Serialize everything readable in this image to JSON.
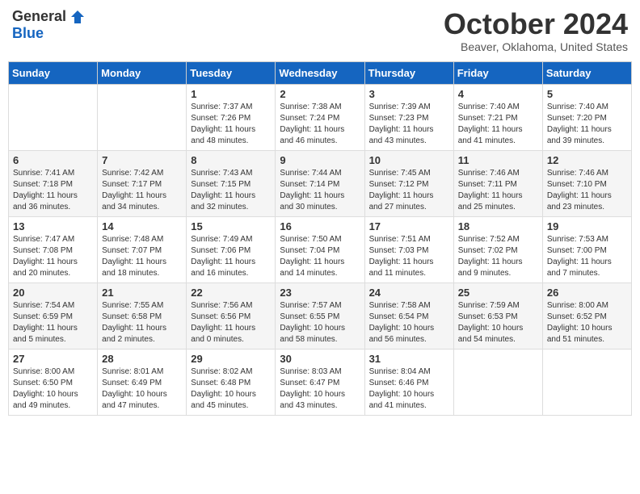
{
  "header": {
    "logo_general": "General",
    "logo_blue": "Blue",
    "month_title": "October 2024",
    "location": "Beaver, Oklahoma, United States"
  },
  "weekdays": [
    "Sunday",
    "Monday",
    "Tuesday",
    "Wednesday",
    "Thursday",
    "Friday",
    "Saturday"
  ],
  "weeks": [
    [
      {
        "day": "",
        "sunrise": "",
        "sunset": "",
        "daylight": ""
      },
      {
        "day": "",
        "sunrise": "",
        "sunset": "",
        "daylight": ""
      },
      {
        "day": "1",
        "sunrise": "Sunrise: 7:37 AM",
        "sunset": "Sunset: 7:26 PM",
        "daylight": "Daylight: 11 hours and 48 minutes."
      },
      {
        "day": "2",
        "sunrise": "Sunrise: 7:38 AM",
        "sunset": "Sunset: 7:24 PM",
        "daylight": "Daylight: 11 hours and 46 minutes."
      },
      {
        "day": "3",
        "sunrise": "Sunrise: 7:39 AM",
        "sunset": "Sunset: 7:23 PM",
        "daylight": "Daylight: 11 hours and 43 minutes."
      },
      {
        "day": "4",
        "sunrise": "Sunrise: 7:40 AM",
        "sunset": "Sunset: 7:21 PM",
        "daylight": "Daylight: 11 hours and 41 minutes."
      },
      {
        "day": "5",
        "sunrise": "Sunrise: 7:40 AM",
        "sunset": "Sunset: 7:20 PM",
        "daylight": "Daylight: 11 hours and 39 minutes."
      }
    ],
    [
      {
        "day": "6",
        "sunrise": "Sunrise: 7:41 AM",
        "sunset": "Sunset: 7:18 PM",
        "daylight": "Daylight: 11 hours and 36 minutes."
      },
      {
        "day": "7",
        "sunrise": "Sunrise: 7:42 AM",
        "sunset": "Sunset: 7:17 PM",
        "daylight": "Daylight: 11 hours and 34 minutes."
      },
      {
        "day": "8",
        "sunrise": "Sunrise: 7:43 AM",
        "sunset": "Sunset: 7:15 PM",
        "daylight": "Daylight: 11 hours and 32 minutes."
      },
      {
        "day": "9",
        "sunrise": "Sunrise: 7:44 AM",
        "sunset": "Sunset: 7:14 PM",
        "daylight": "Daylight: 11 hours and 30 minutes."
      },
      {
        "day": "10",
        "sunrise": "Sunrise: 7:45 AM",
        "sunset": "Sunset: 7:12 PM",
        "daylight": "Daylight: 11 hours and 27 minutes."
      },
      {
        "day": "11",
        "sunrise": "Sunrise: 7:46 AM",
        "sunset": "Sunset: 7:11 PM",
        "daylight": "Daylight: 11 hours and 25 minutes."
      },
      {
        "day": "12",
        "sunrise": "Sunrise: 7:46 AM",
        "sunset": "Sunset: 7:10 PM",
        "daylight": "Daylight: 11 hours and 23 minutes."
      }
    ],
    [
      {
        "day": "13",
        "sunrise": "Sunrise: 7:47 AM",
        "sunset": "Sunset: 7:08 PM",
        "daylight": "Daylight: 11 hours and 20 minutes."
      },
      {
        "day": "14",
        "sunrise": "Sunrise: 7:48 AM",
        "sunset": "Sunset: 7:07 PM",
        "daylight": "Daylight: 11 hours and 18 minutes."
      },
      {
        "day": "15",
        "sunrise": "Sunrise: 7:49 AM",
        "sunset": "Sunset: 7:06 PM",
        "daylight": "Daylight: 11 hours and 16 minutes."
      },
      {
        "day": "16",
        "sunrise": "Sunrise: 7:50 AM",
        "sunset": "Sunset: 7:04 PM",
        "daylight": "Daylight: 11 hours and 14 minutes."
      },
      {
        "day": "17",
        "sunrise": "Sunrise: 7:51 AM",
        "sunset": "Sunset: 7:03 PM",
        "daylight": "Daylight: 11 hours and 11 minutes."
      },
      {
        "day": "18",
        "sunrise": "Sunrise: 7:52 AM",
        "sunset": "Sunset: 7:02 PM",
        "daylight": "Daylight: 11 hours and 9 minutes."
      },
      {
        "day": "19",
        "sunrise": "Sunrise: 7:53 AM",
        "sunset": "Sunset: 7:00 PM",
        "daylight": "Daylight: 11 hours and 7 minutes."
      }
    ],
    [
      {
        "day": "20",
        "sunrise": "Sunrise: 7:54 AM",
        "sunset": "Sunset: 6:59 PM",
        "daylight": "Daylight: 11 hours and 5 minutes."
      },
      {
        "day": "21",
        "sunrise": "Sunrise: 7:55 AM",
        "sunset": "Sunset: 6:58 PM",
        "daylight": "Daylight: 11 hours and 2 minutes."
      },
      {
        "day": "22",
        "sunrise": "Sunrise: 7:56 AM",
        "sunset": "Sunset: 6:56 PM",
        "daylight": "Daylight: 11 hours and 0 minutes."
      },
      {
        "day": "23",
        "sunrise": "Sunrise: 7:57 AM",
        "sunset": "Sunset: 6:55 PM",
        "daylight": "Daylight: 10 hours and 58 minutes."
      },
      {
        "day": "24",
        "sunrise": "Sunrise: 7:58 AM",
        "sunset": "Sunset: 6:54 PM",
        "daylight": "Daylight: 10 hours and 56 minutes."
      },
      {
        "day": "25",
        "sunrise": "Sunrise: 7:59 AM",
        "sunset": "Sunset: 6:53 PM",
        "daylight": "Daylight: 10 hours and 54 minutes."
      },
      {
        "day": "26",
        "sunrise": "Sunrise: 8:00 AM",
        "sunset": "Sunset: 6:52 PM",
        "daylight": "Daylight: 10 hours and 51 minutes."
      }
    ],
    [
      {
        "day": "27",
        "sunrise": "Sunrise: 8:00 AM",
        "sunset": "Sunset: 6:50 PM",
        "daylight": "Daylight: 10 hours and 49 minutes."
      },
      {
        "day": "28",
        "sunrise": "Sunrise: 8:01 AM",
        "sunset": "Sunset: 6:49 PM",
        "daylight": "Daylight: 10 hours and 47 minutes."
      },
      {
        "day": "29",
        "sunrise": "Sunrise: 8:02 AM",
        "sunset": "Sunset: 6:48 PM",
        "daylight": "Daylight: 10 hours and 45 minutes."
      },
      {
        "day": "30",
        "sunrise": "Sunrise: 8:03 AM",
        "sunset": "Sunset: 6:47 PM",
        "daylight": "Daylight: 10 hours and 43 minutes."
      },
      {
        "day": "31",
        "sunrise": "Sunrise: 8:04 AM",
        "sunset": "Sunset: 6:46 PM",
        "daylight": "Daylight: 10 hours and 41 minutes."
      },
      {
        "day": "",
        "sunrise": "",
        "sunset": "",
        "daylight": ""
      },
      {
        "day": "",
        "sunrise": "",
        "sunset": "",
        "daylight": ""
      }
    ]
  ]
}
